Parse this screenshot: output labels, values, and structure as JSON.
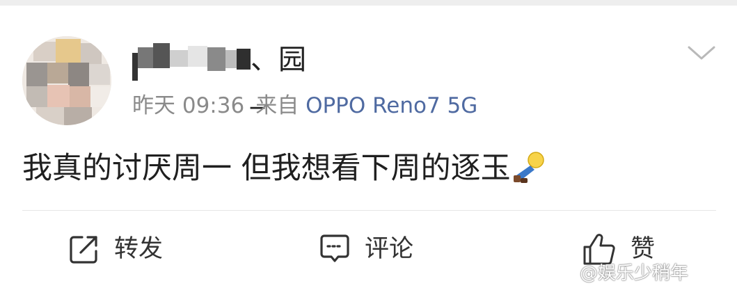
{
  "post": {
    "username_tail": "、园_",
    "timestamp": "昨天 09:36",
    "source_prefix": "来自",
    "source_device": "OPPO Reno7 5G",
    "body_text": "我真的讨厌周一 但我想看下周的逐玉"
  },
  "icons": {
    "menu": "chevron-down-icon",
    "emoji": "lying-person-emoji",
    "repost": "share-arrow-icon",
    "comment": "comment-bubble-icon",
    "like": "thumbs-up-icon"
  },
  "actions": {
    "repost_label": "转发",
    "comment_label": "评论",
    "like_label": "赞"
  },
  "watermark": "@娱乐少稍年",
  "colors": {
    "source_link": "#4f6aa1",
    "meta_text": "#8a8a8a",
    "body_text": "#1f1f1f",
    "divider": "#e6e6e6"
  }
}
